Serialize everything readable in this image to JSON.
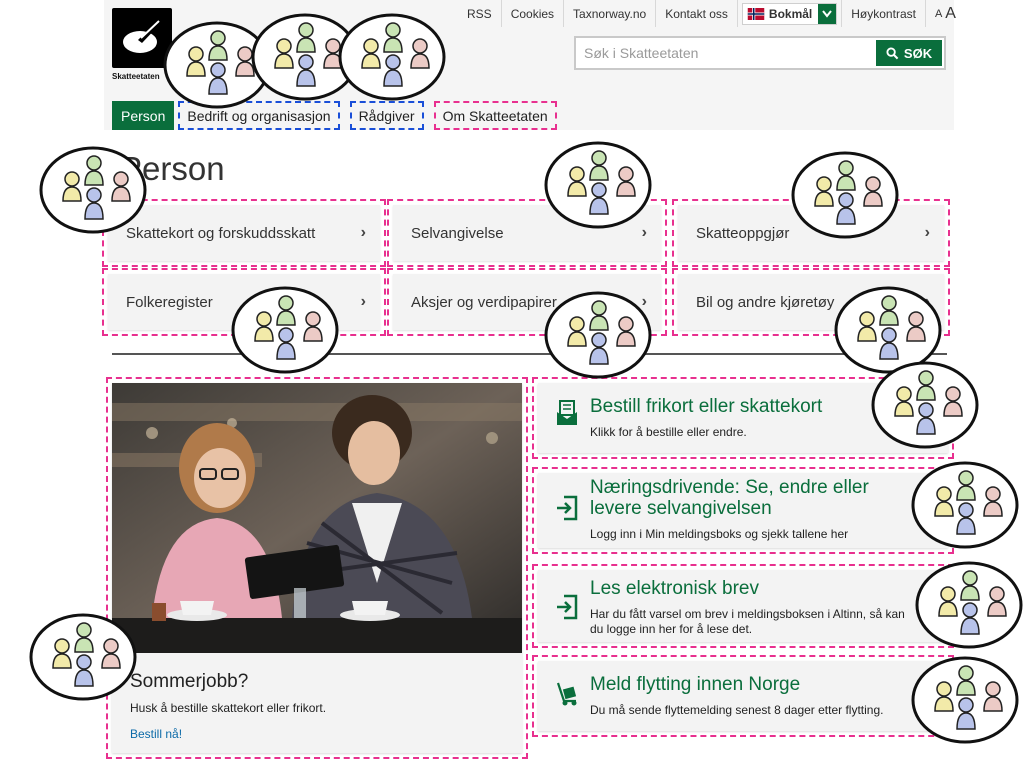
{
  "brand": {
    "name": "Skatteetaten"
  },
  "topbar": {
    "links": [
      "RSS",
      "Cookies",
      "Taxnorway.no",
      "Kontakt oss"
    ],
    "language": "Bokmål",
    "contrast": "Høykontrast",
    "font_small": "A",
    "font_big": "A"
  },
  "search": {
    "placeholder": "Søk i Skatteetaten",
    "button": "SØK"
  },
  "nav": {
    "person": "Person",
    "bedrift": "Bedrift og organisasjon",
    "radgiver": "Rådgiver",
    "om": "Om Skatteetaten"
  },
  "page": {
    "title": "Person"
  },
  "cards": [
    {
      "label": "Skattekort og forskuddsskatt"
    },
    {
      "label": "Selvangivelse"
    },
    {
      "label": "Skatteoppgjør"
    },
    {
      "label": "Folkeregister"
    },
    {
      "label": "Aksjer og verdipapirer"
    },
    {
      "label": "Bil og andre kjøretøy"
    }
  ],
  "promo": {
    "title": "Sommerjobb?",
    "text": "Husk å bestille skattekort eller frikort.",
    "link": "Bestill nå!"
  },
  "actions": [
    {
      "icon": "envelope-document-icon",
      "title": "Bestill frikort eller skattekort",
      "desc": "Klikk for å bestille eller endre."
    },
    {
      "icon": "login-door-icon",
      "title": "Næringsdrivende: Se, endre eller levere selvangivelsen",
      "desc": "Logg inn i Min meldingsboks og sjekk tallene her"
    },
    {
      "icon": "login-door-icon",
      "title": "Les elektronisk brev",
      "desc": "Har du fått varsel om brev i meldingsboksen i Altinn, så kan du logge inn her for å lese det."
    },
    {
      "icon": "hand-truck-icon",
      "title": "Meld flytting innen Norge",
      "desc": "Du må sende flyttemelding senest 8 dager etter flytting."
    }
  ],
  "colors": {
    "brand_green": "#0a6e3c",
    "highlight_pink": "#e8308f",
    "highlight_blue": "#1a4fd8",
    "link_blue": "#0b6aa8"
  }
}
